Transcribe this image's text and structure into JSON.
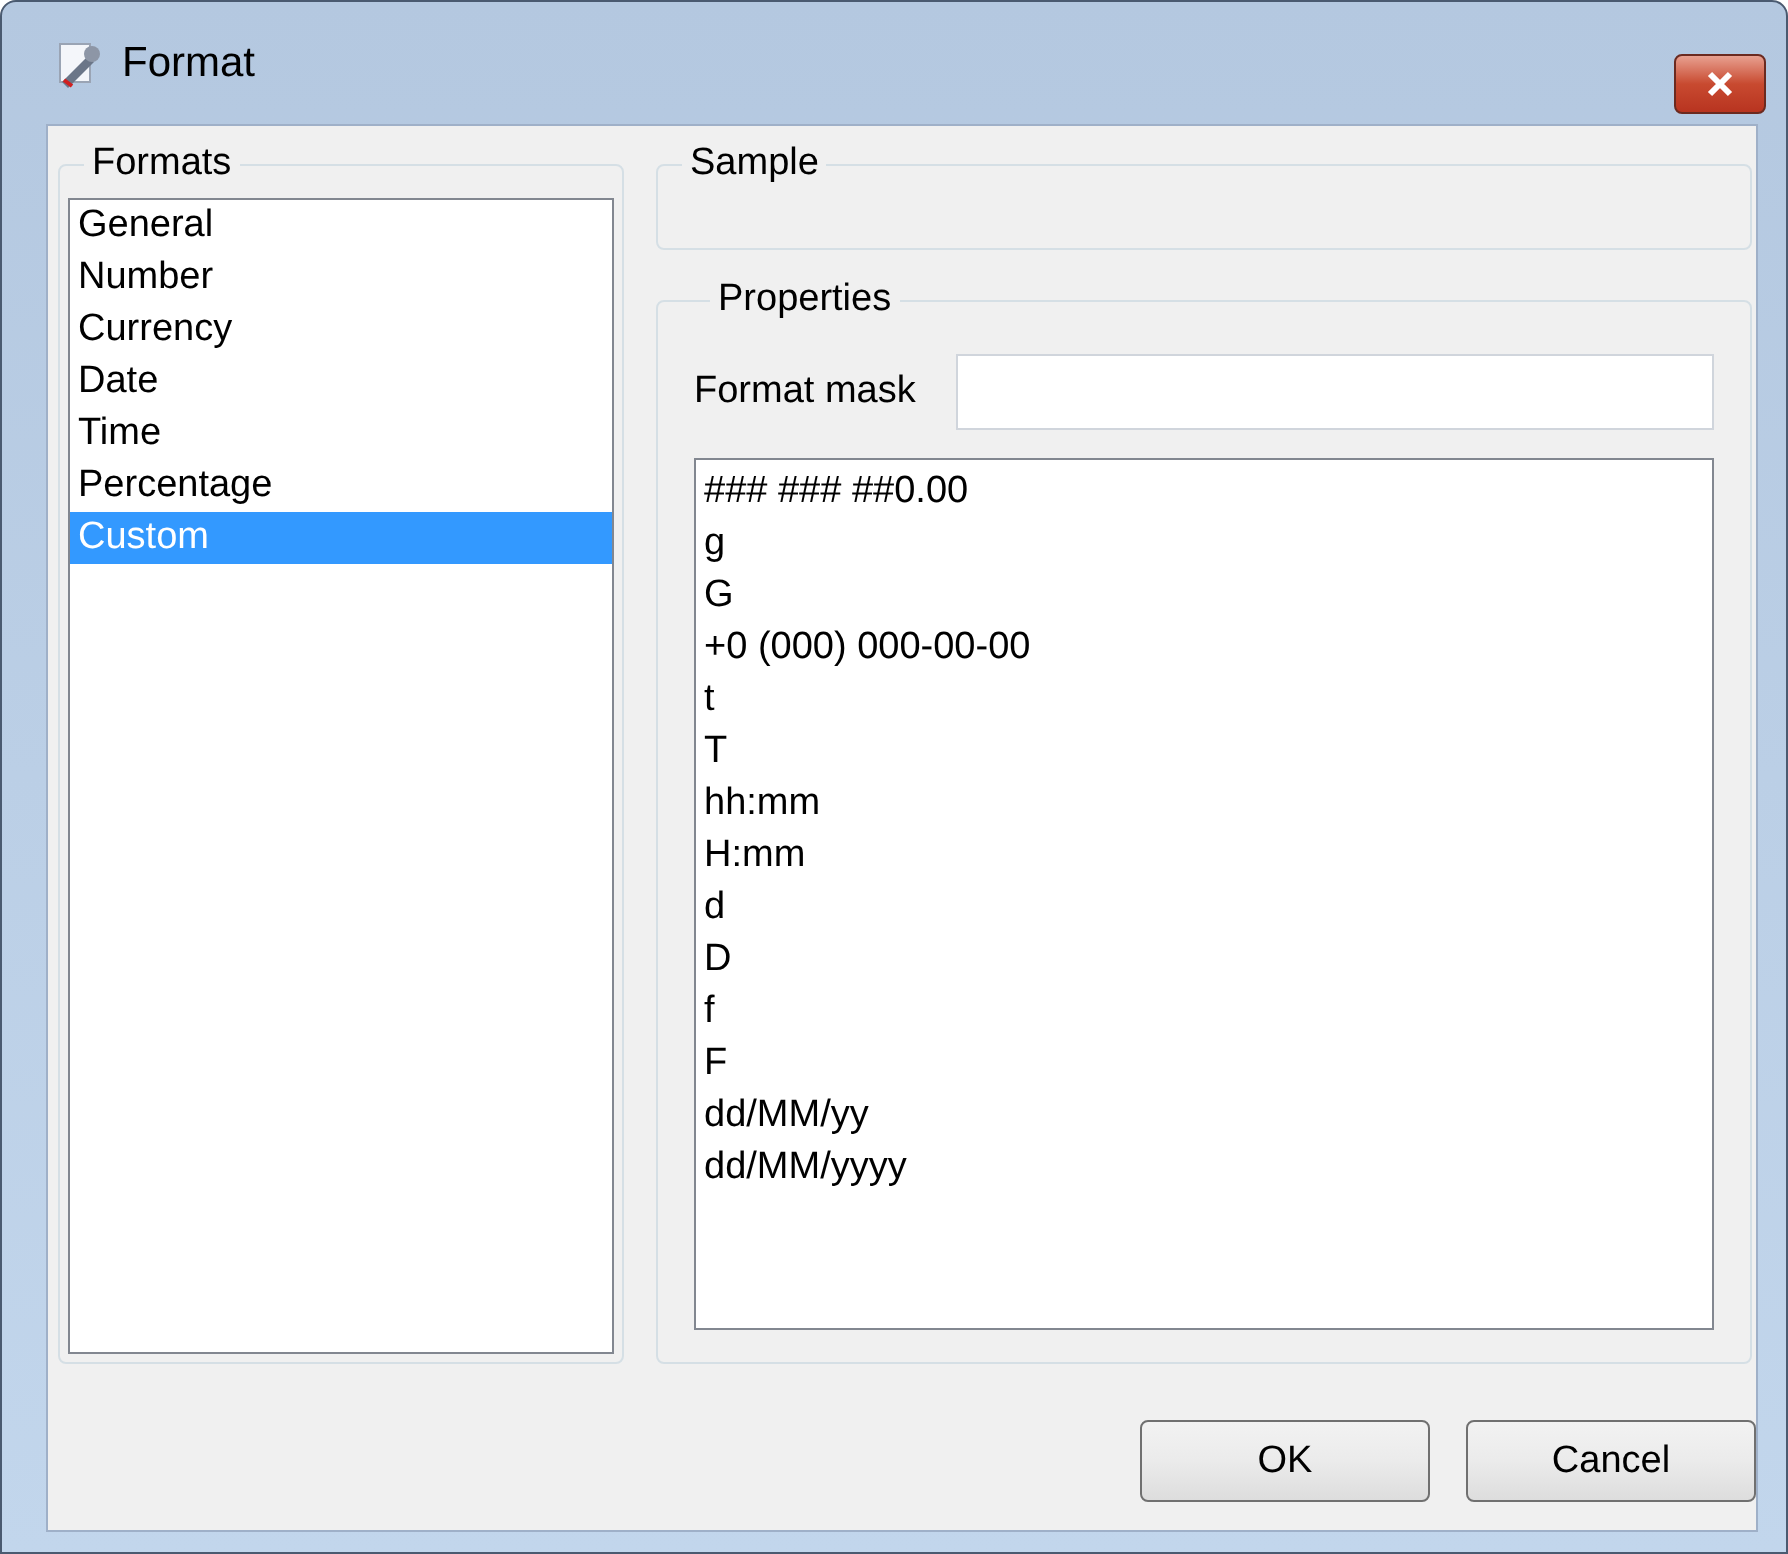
{
  "window": {
    "title": "Format"
  },
  "formats": {
    "label": "Formats",
    "items": [
      {
        "label": "General",
        "selected": false
      },
      {
        "label": "Number",
        "selected": false
      },
      {
        "label": "Currency",
        "selected": false
      },
      {
        "label": "Date",
        "selected": false
      },
      {
        "label": "Time",
        "selected": false
      },
      {
        "label": "Percentage",
        "selected": false
      },
      {
        "label": "Custom",
        "selected": true
      }
    ]
  },
  "sample": {
    "label": "Sample"
  },
  "properties": {
    "label": "Properties",
    "format_mask": {
      "label": "Format mask"
    },
    "masks": [
      "### ### ##0.00",
      "g",
      "G",
      "+0 (000) 000-00-00",
      "t",
      "T",
      "hh:mm",
      "H:mm",
      "d",
      "D",
      "f",
      "F",
      "dd/MM/yy",
      "dd/MM/yyyy"
    ]
  },
  "buttons": [
    "OK",
    "Cancel"
  ]
}
